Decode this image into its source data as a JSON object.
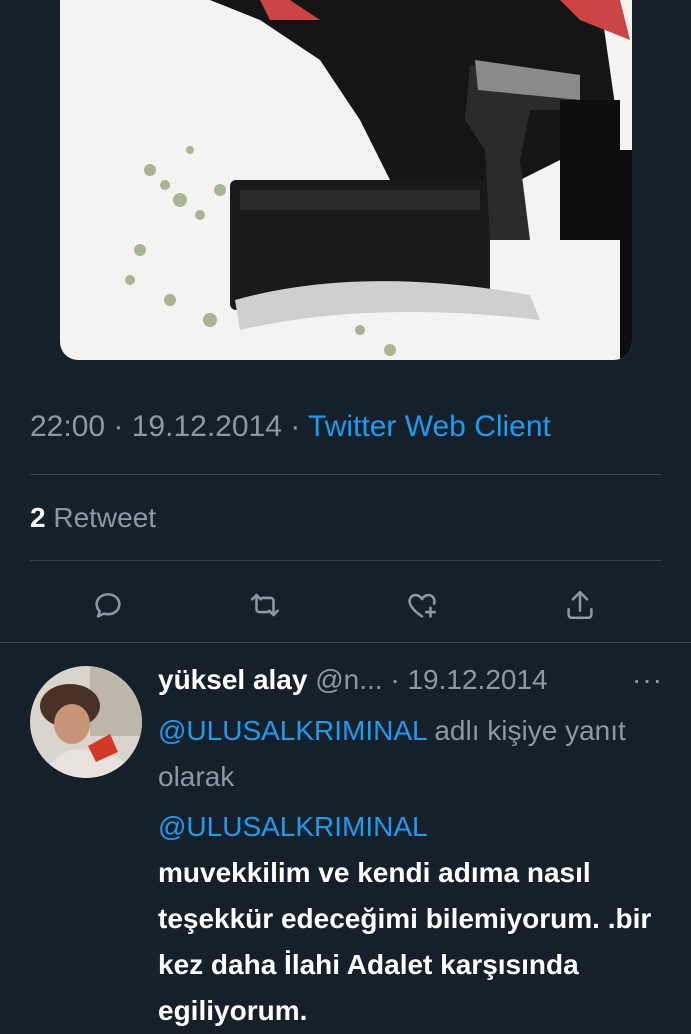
{
  "tweet": {
    "time": "22:00",
    "date": "19.12.2014",
    "separator": " · ",
    "source": "Twitter Web Client",
    "retweet_count": "2",
    "retweet_label": "Retweet"
  },
  "actions": {
    "reply_icon": "reply-icon",
    "retweet_icon": "retweet-icon",
    "like_icon": "like-icon",
    "share_icon": "share-icon"
  },
  "reply": {
    "display_name": "yüksel alay",
    "handle": "@n...",
    "date": "19.12.2014",
    "dot": " · ",
    "more": "···",
    "replying_handle": "@ULUSALKRIMINAL",
    "replying_text": " adlı kişiye yanıt olarak",
    "mention": "@ULUSALKRIMINAL",
    "text": "muvekkilim ve kendi adıma nasıl teşekkür edeceğimi bilemiyorum.  .bir kez daha İlahi Adalet karşısında egiliyorum."
  },
  "colors": {
    "background": "#15202b",
    "accent": "#1d9bf0",
    "muted": "#8b98a5",
    "divider": "#38444d"
  }
}
